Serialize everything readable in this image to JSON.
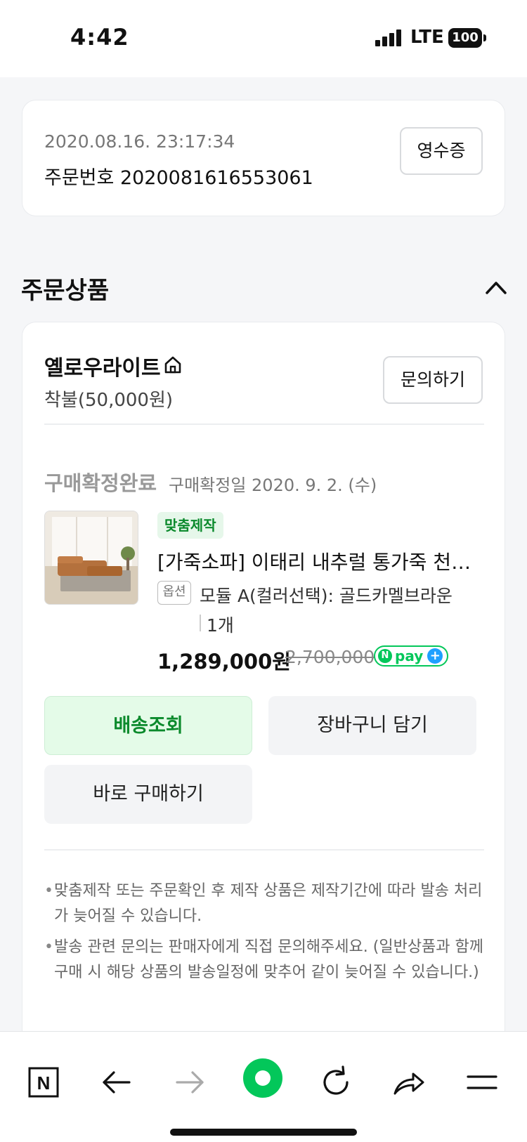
{
  "status_bar": {
    "time": "4:42",
    "network": "LTE",
    "battery": "100"
  },
  "order": {
    "datetime": "2020.08.16. 23:17:34",
    "number_label": "주문번호 2020081616553061",
    "receipt_button": "영수증"
  },
  "section": {
    "title": "주문상품"
  },
  "seller": {
    "name": "옐로우라이트",
    "shipping_fee": "착불(50,000원)",
    "inquiry_button": "문의하기"
  },
  "purchase": {
    "status": "구매확정완료",
    "confirm_date": "구매확정일 2020. 9. 2. (수)"
  },
  "product": {
    "badge": "맞춤제작",
    "name": "[가죽소파] 이태리 내추럴 통가죽 천연...",
    "option_tag": "옵션",
    "option_text": "모듈 A(컬러선택): 골드카멜브라운",
    "quantity": "1개",
    "price": "1,289,000원",
    "original_price": "2,700,000",
    "npay_label": "pay",
    "npay_n": "N",
    "npay_plus": "+"
  },
  "actions": {
    "delivery": "배송조회",
    "cart": "장바구니 담기",
    "buy_now": "바로 구매하기"
  },
  "notes": [
    "맞춤제작 또는 주문확인 후 제작 상품은 제작기간에 따라 발송 처리가 늦어질 수 있습니다.",
    "발송 관련 문의는 판매자에게 직접 문의해주세요. (일반상품과 함께 구매 시 해당 상품의 발송일정에 맞추어 같이 늦어질 수 있습니다.)"
  ],
  "bottom_nav": {
    "icons": [
      "naver-home-icon",
      "back-arrow-icon",
      "forward-arrow-icon",
      "green-dot-icon",
      "refresh-icon",
      "share-icon",
      "menu-icon"
    ],
    "naver_logo": "N"
  },
  "colors": {
    "accent_green": "#03c75a",
    "text_green": "#0b8a2c",
    "npay_blue": "#1ea0ff"
  }
}
